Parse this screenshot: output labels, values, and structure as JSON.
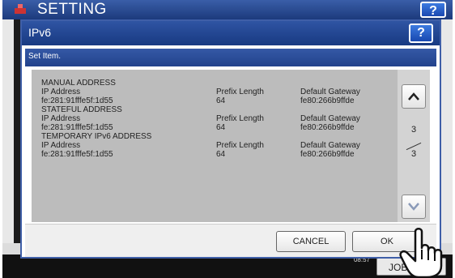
{
  "background_window": {
    "title": "SETTING",
    "help_label": "?"
  },
  "dialog": {
    "title": "IPv6",
    "help_label": "?",
    "subheader": "Set Item.",
    "sections": [
      {
        "heading": "MANUAL ADDRESS",
        "ip_label": "IP Address",
        "ip_value": "fe:281:91fffe5f:1d55",
        "prefix_label": "Prefix Length",
        "prefix_value": "64",
        "gateway_label": "Default Gateway",
        "gateway_value": "fe80:266b9ffde"
      },
      {
        "heading": "STATEFUL ADDRESS",
        "ip_label": "IP Address",
        "ip_value": "fe:281:91fffe5f:1d55",
        "prefix_label": "Prefix Length",
        "prefix_value": "64",
        "gateway_label": "Default Gateway",
        "gateway_value": "fe80:266b9ffde"
      },
      {
        "heading": "TEMPORARY IPv6 ADDRESS",
        "ip_label": "IP Address",
        "ip_value": "fe:281:91fffe5f:1d55",
        "prefix_label": "Prefix Length",
        "prefix_value": "64",
        "gateway_label": "Default Gateway",
        "gateway_value": "fe80:266b9ffde"
      }
    ],
    "page": {
      "current": "3",
      "total": "3"
    },
    "cancel_label": "CANCEL",
    "ok_label": "OK"
  },
  "status_bar": {
    "clock": "08:57",
    "job_label": "JOB"
  },
  "icons": {
    "up": "chevron-up-icon",
    "down": "chevron-down-icon",
    "pointer": "hand-pointer-icon"
  },
  "colors": {
    "title_blue": "#1c3a7c",
    "panel_gray": "#bcbcbc"
  }
}
